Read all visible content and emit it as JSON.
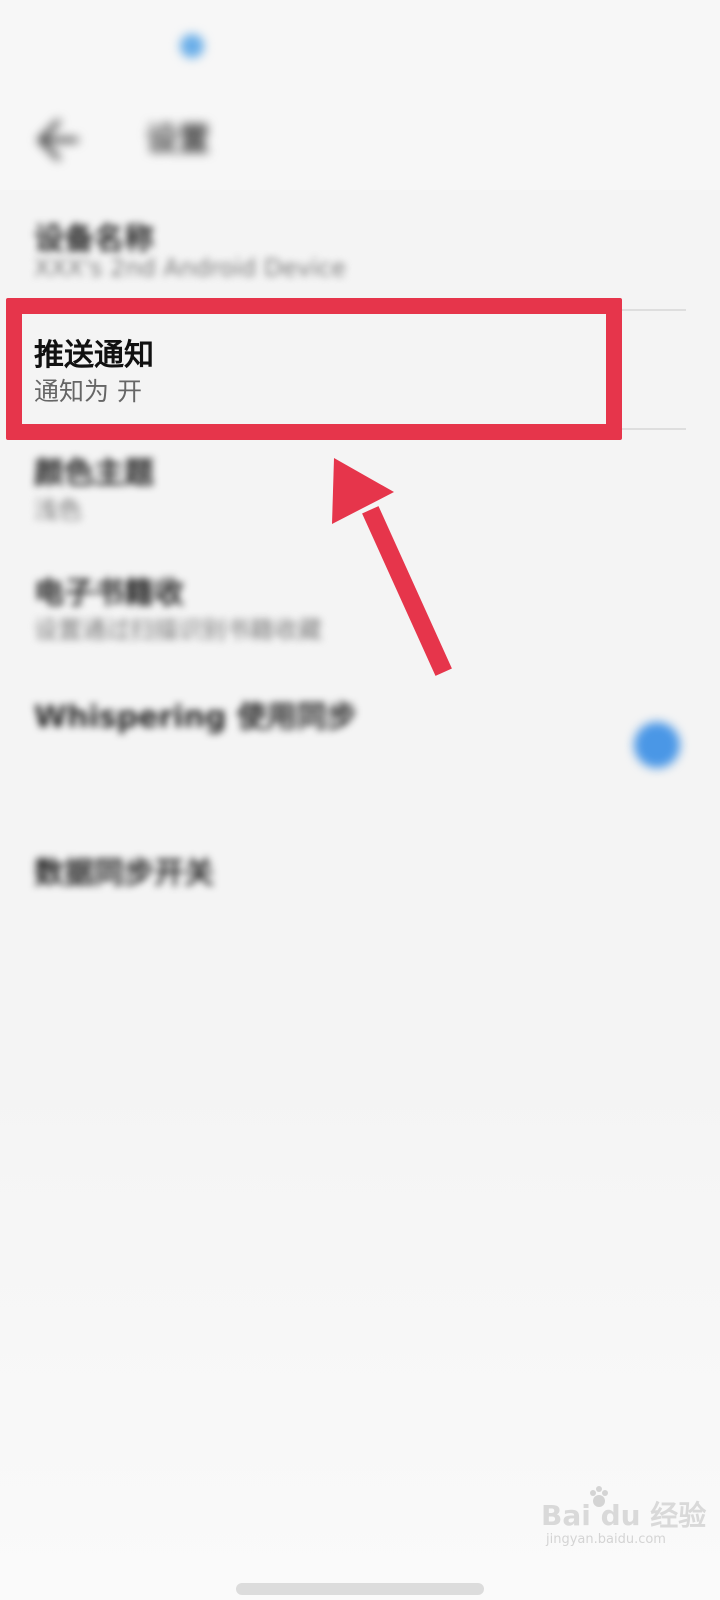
{
  "status_bar": {
    "time": "",
    "right_status": ""
  },
  "app_bar": {
    "title": "设置"
  },
  "settings": {
    "items": [
      {
        "title": "设备名称",
        "subtitle": "XXX's 2nd Android Device"
      },
      {
        "title": "推送通知",
        "subtitle": "通知为 开"
      },
      {
        "title": "颜色主题",
        "subtitle": "浅色"
      },
      {
        "title": "电子书籍收",
        "subtitle": "设置通过扫描识别书籍收藏"
      },
      {
        "title": "Whispering 使用同步",
        "subtitle": "",
        "toggle": true
      },
      {
        "title": "数据同步开关",
        "subtitle": ""
      }
    ]
  },
  "highlight": {
    "color": "#e6354b"
  },
  "watermark": {
    "brand": "Bai du 经验",
    "url": "jingyan.baidu.com"
  }
}
